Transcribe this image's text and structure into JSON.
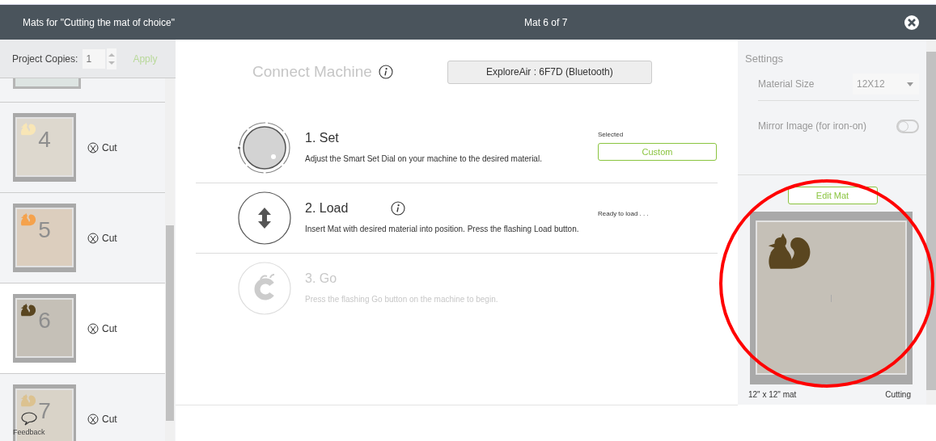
{
  "window": {
    "title": "Mats for \"Cutting the mat of choice\"",
    "mat_counter": "Mat 6 of 7"
  },
  "project_copies": {
    "label": "Project Copies:",
    "placeholder": "1",
    "apply": "Apply",
    "apply_disabled": true
  },
  "mats": [
    {
      "number": "4",
      "action": "Cut",
      "selected": false,
      "color": "#f8e6b6"
    },
    {
      "number": "5",
      "action": "Cut",
      "selected": false,
      "color": "#f5a24c"
    },
    {
      "number": "6",
      "action": "Cut",
      "selected": true,
      "color": "#5a4620"
    },
    {
      "number": "7",
      "action": "Cut",
      "selected": false,
      "color": "#dcc290"
    }
  ],
  "feedback": "Feedback",
  "connect": {
    "heading": "Connect Machine",
    "machine": "ExploreAir : 6F7D (Bluetooth)"
  },
  "steps": [
    {
      "kind": "set",
      "title": "1. Set",
      "description": "Adjust the Smart Set Dial on your machine to the desired material.",
      "status": "Selected",
      "button": "Custom",
      "info": false,
      "disabled": false
    },
    {
      "kind": "load",
      "title": "2. Load",
      "description": "Insert Mat with desired material into position. Press the flashing Load button.",
      "status": "Ready to load . . .",
      "info": true,
      "disabled": false
    },
    {
      "kind": "go",
      "title": "3. Go",
      "description": "Press the flashing Go button on the machine to begin.",
      "info": false,
      "disabled": true
    }
  ],
  "settings": {
    "title": "Settings",
    "material_size_label": "Material Size",
    "material_size": "12X12",
    "mirror_label": "Mirror Image (for iron-on)",
    "mirror_on": false
  },
  "preview": {
    "edit_button": "Edit Mat",
    "color": "#5a4620",
    "size": "12\" x 12\" mat",
    "mode": "Cutting"
  },
  "highlight_circle": true
}
